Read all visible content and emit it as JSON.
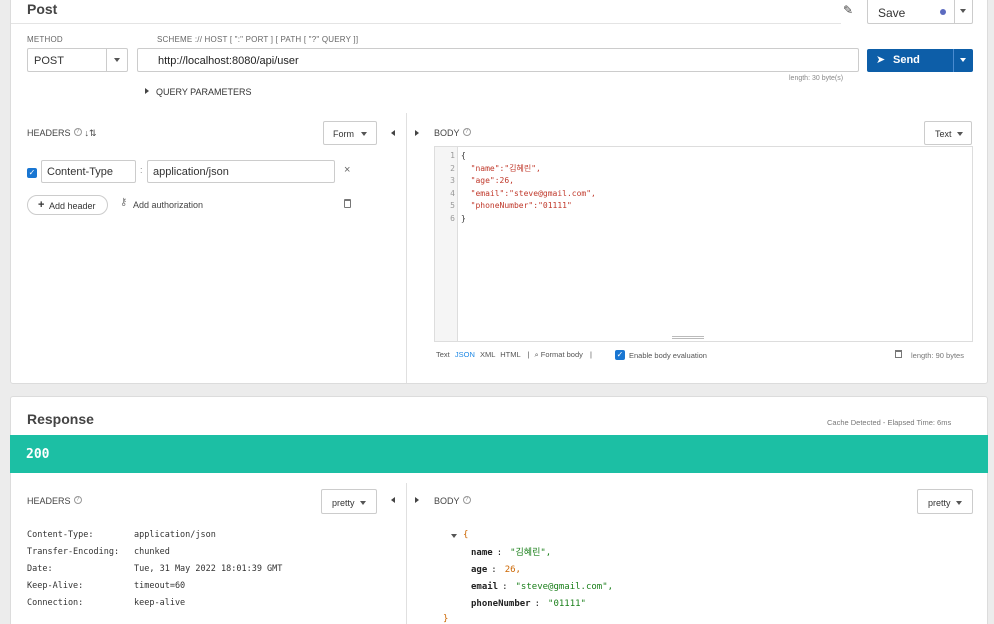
{
  "request": {
    "title": "Post",
    "save_label": "Save",
    "method_label": "METHOD",
    "method_value": "POST",
    "url_label": "SCHEME :// HOST [ \":\" PORT ] [ PATH [ \"?\" QUERY ]]",
    "url_value": "http://localhost:8080/api/user",
    "url_length": "length: 30 byte(s)",
    "send_label": "Send",
    "query_params_label": "QUERY PARAMETERS",
    "headers_label": "HEADERS",
    "headers_mode": "Form",
    "header_key": "Content-Type",
    "header_sep": ":",
    "header_value": "application/json",
    "add_header_label": "Add header",
    "add_auth_label": "Add authorization",
    "body_label": "BODY",
    "body_mode": "Text",
    "body_lines": [
      {
        "num": "1",
        "text": "{"
      },
      {
        "num": "2",
        "text": "  \"name\":\"김혜린\","
      },
      {
        "num": "3",
        "text": "  \"age\":26,"
      },
      {
        "num": "4",
        "text": "  \"email\":\"steve@gmail.com\","
      },
      {
        "num": "5",
        "text": "  \"phoneNumber\":\"01111\""
      },
      {
        "num": "6",
        "text": "}"
      }
    ],
    "body_formats": [
      "Text",
      "JSON",
      "XML",
      "HTML"
    ],
    "format_body_label": "Format body",
    "enable_eval_label": "Enable body evaluation",
    "body_length": "length: 90 bytes",
    "sep": "|"
  },
  "response": {
    "title": "Response",
    "meta": "Cache Detected - Elapsed Time: 6ms",
    "status": "200",
    "headers_label": "HEADERS",
    "headers_mode": "pretty",
    "body_label": "BODY",
    "body_mode": "pretty",
    "headers": [
      {
        "key": "Content-Type:",
        "value": "application/json"
      },
      {
        "key": "Transfer-Encoding:",
        "value": "chunked"
      },
      {
        "key": "Date:",
        "value": "Tue, 31 May 2022 18:01:39 GMT"
      },
      {
        "key": "Keep-Alive:",
        "value": "timeout=60"
      },
      {
        "key": "Connection:",
        "value": "keep-alive"
      }
    ],
    "json_open": "{",
    "json_close": "}",
    "json_fields": [
      {
        "key": "name",
        "colon": ":",
        "value": "\"김혜린\","
      },
      {
        "key": "age",
        "colon": ":",
        "value": "26,"
      },
      {
        "key": "email",
        "colon": ":",
        "value": "\"steve@gmail.com\","
      },
      {
        "key": "phoneNumber",
        "colon": ":",
        "value": "\"01111\""
      }
    ]
  },
  "colors": {
    "accent": "#0d5ea8",
    "status_ok": "#1cbfa4",
    "checkbox": "#1976d2",
    "json_key": "#d14",
    "json_string": "#1a7f1a",
    "json_number": "#cc6600"
  }
}
